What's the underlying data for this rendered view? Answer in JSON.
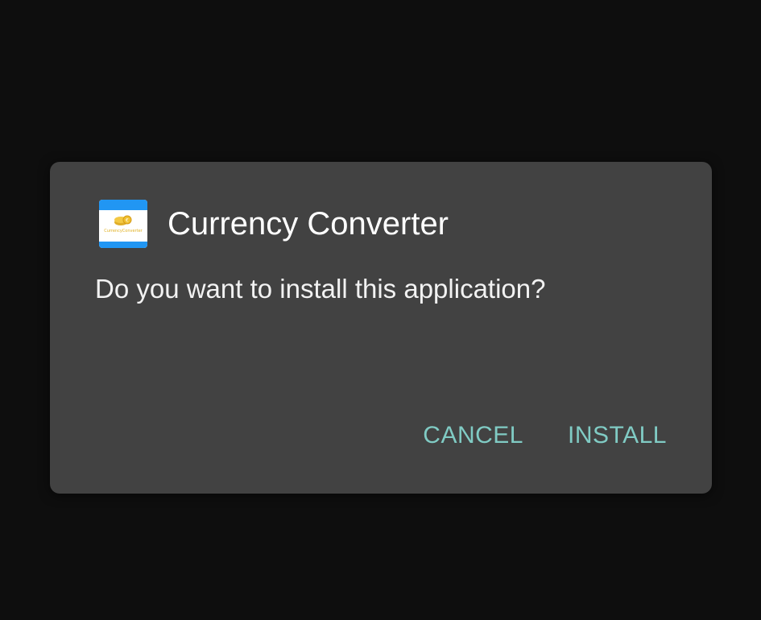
{
  "dialog": {
    "app_icon": {
      "name": "currency-converter-app-icon",
      "caption": "CurrencyConverter",
      "colors": {
        "band": "#2196f3",
        "coin": "#f0c030",
        "background": "#ffffff"
      }
    },
    "title": "Currency Converter",
    "message": "Do you want to install this application?",
    "buttons": {
      "cancel": "CANCEL",
      "install": "INSTALL"
    }
  },
  "colors": {
    "screen_background": "#0e0e0e",
    "dialog_background": "#424242",
    "accent": "#80cbc4",
    "title_text": "#ffffff"
  }
}
